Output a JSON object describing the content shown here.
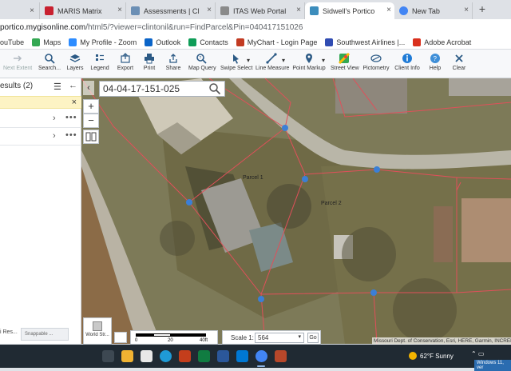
{
  "browser": {
    "tabs": [
      {
        "label": "MARIS Matrix",
        "color": "#c8202f"
      },
      {
        "label": "Assessments | Clinton Co",
        "color": "#6b8fb5"
      },
      {
        "label": "ITAS Web Portal",
        "color": "#8a8a8a"
      },
      {
        "label": "Sidwell's Portico",
        "color": "#3c8dbc",
        "active": true
      },
      {
        "label": "New Tab",
        "color": "#4285f4"
      }
    ],
    "tab_close": "×",
    "new_tab": "+",
    "url_host": "portico.mygisonline.com",
    "url_path": "/html5/?viewer=clintonil&run=FindParcel&Pin=040417151026",
    "bookmarks": [
      {
        "label": "ouTube",
        "color": "#ff0000"
      },
      {
        "label": "Maps",
        "color": "#34a853"
      },
      {
        "label": "My Profile - Zoom",
        "color": "#2d8cff"
      },
      {
        "label": "Outlook",
        "color": "#0a64c8"
      },
      {
        "label": "Contacts",
        "color": "#0f9d58"
      },
      {
        "label": "MyChart - Login Page",
        "color": "#c23b22"
      },
      {
        "label": "Southwest Airlines |...",
        "color": "#304cb2"
      },
      {
        "label": "Adobe Acrobat",
        "color": "#d9301d"
      }
    ]
  },
  "toolbar": {
    "tools": [
      {
        "label": "Next Extent",
        "icon": "next-extent-icon",
        "disabled": true
      },
      {
        "label": "Search...",
        "icon": "search-icon"
      },
      {
        "label": "Layers",
        "icon": "layers-icon"
      },
      {
        "label": "Legend",
        "icon": "legend-icon"
      },
      {
        "label": "Export",
        "icon": "export-icon"
      },
      {
        "label": "Print",
        "icon": "print-icon"
      },
      {
        "label": "Share",
        "icon": "share-icon"
      },
      {
        "label": "Map Query",
        "icon": "map-query-icon"
      },
      {
        "label": "Swipe Select",
        "icon": "swipe-select-icon"
      },
      {
        "label": "Line Measure",
        "icon": "line-measure-icon"
      },
      {
        "label": "Point Markup",
        "icon": "point-markup-icon"
      },
      {
        "label": "Street View",
        "icon": "street-view-icon"
      },
      {
        "label": "Pictometry",
        "icon": "pictometry-icon"
      },
      {
        "label": "Client Info",
        "icon": "client-info-icon"
      },
      {
        "label": "Help",
        "icon": "help-icon"
      },
      {
        "label": "Clear",
        "icon": "clear-icon"
      }
    ]
  },
  "left_panel": {
    "title": "esults (2)",
    "yellow_close": "×",
    "row_chevron": "›",
    "row_more": "•••",
    "footer_label": "i Res...",
    "snappable_label": "Snappable ..."
  },
  "map": {
    "pin_search_value": "04-04-17-151-025",
    "zoom_in": "+",
    "zoom_out": "−",
    "collapse": "‹",
    "parcel_labels": [
      "Parcel 1",
      "Parcel 2"
    ],
    "basemap_label": "World Str...",
    "scale_ticks": [
      "0",
      "20",
      "40ft"
    ],
    "scale_label": "Scale 1:",
    "scale_value": "564",
    "scale_go": "Go",
    "attribution": "Missouri Dept. of Conservation, Esri, HERE, Garmin, INCREMENT P"
  },
  "taskbar": {
    "weather": "62°F  Sunny",
    "toast": "Windows 11, ver",
    "colors": {
      "accent": "#8fb6e6",
      "parcel_line": "#e0505a",
      "vertex": "#3b7fd6"
    }
  }
}
